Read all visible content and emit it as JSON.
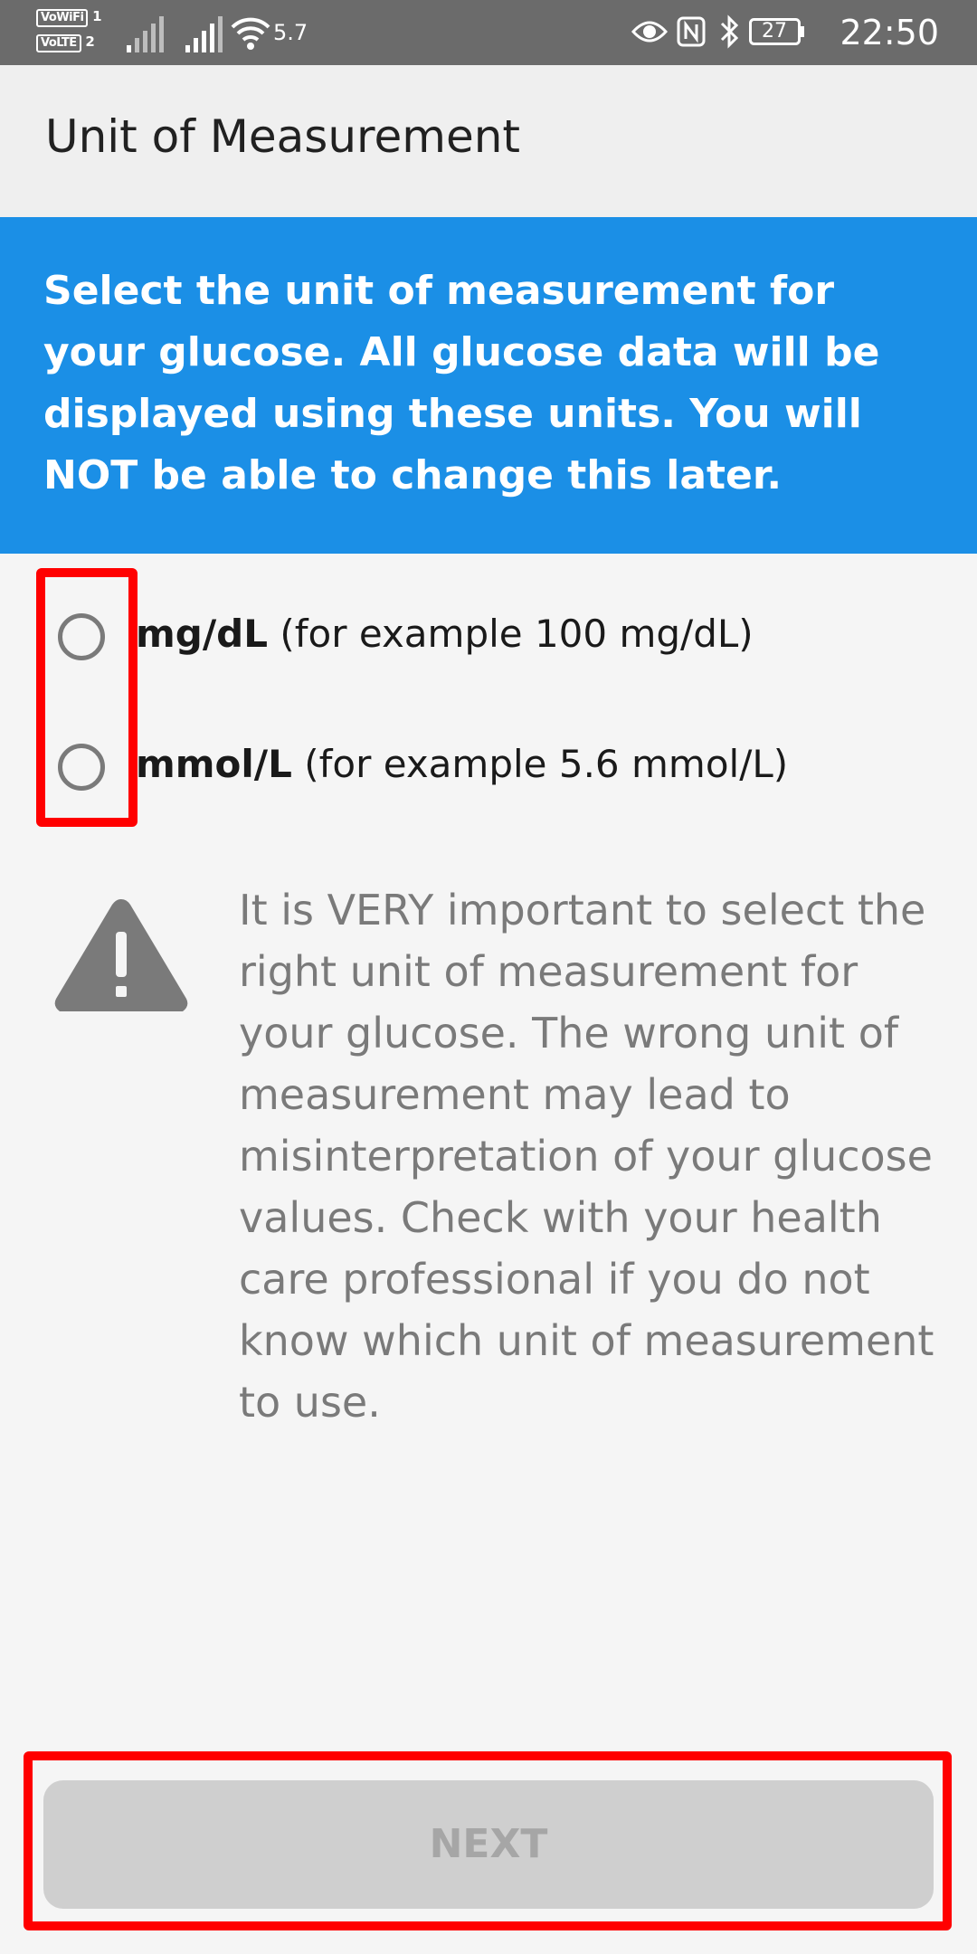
{
  "status_bar": {
    "vowifi": "VoWiFi",
    "sim1": "1",
    "volte": "VoLTE",
    "sim2": "2",
    "speed": "5.7",
    "battery": "27",
    "time": "22:50"
  },
  "app_bar": {
    "title": "Unit of Measurement"
  },
  "banner": {
    "text": "Select the unit of measurement for your glucose. All glucose data will be displayed using these units. You will NOT be able to change this later."
  },
  "options": [
    {
      "unit": "mg/dL",
      "example": " (for example 100 mg/dL)",
      "selected": false
    },
    {
      "unit": "mmol/L",
      "example": " (for example 5.6 mmol/L)",
      "selected": false
    }
  ],
  "warning": {
    "icon": "warning-triangle-icon",
    "text": "It is VERY important to select the right unit of measurement for your glucose. The wrong unit of measurement may lead to misinterpretation of your glucose values. Check with your health care professional if you do not know which unit of measurement to use."
  },
  "next_button": {
    "label": "NEXT",
    "enabled": false
  },
  "colors": {
    "status_bar": "#6b6b6b",
    "banner": "#1b8fe6",
    "highlight": "#ff0000",
    "button_disabled": "#cfcfcf"
  }
}
